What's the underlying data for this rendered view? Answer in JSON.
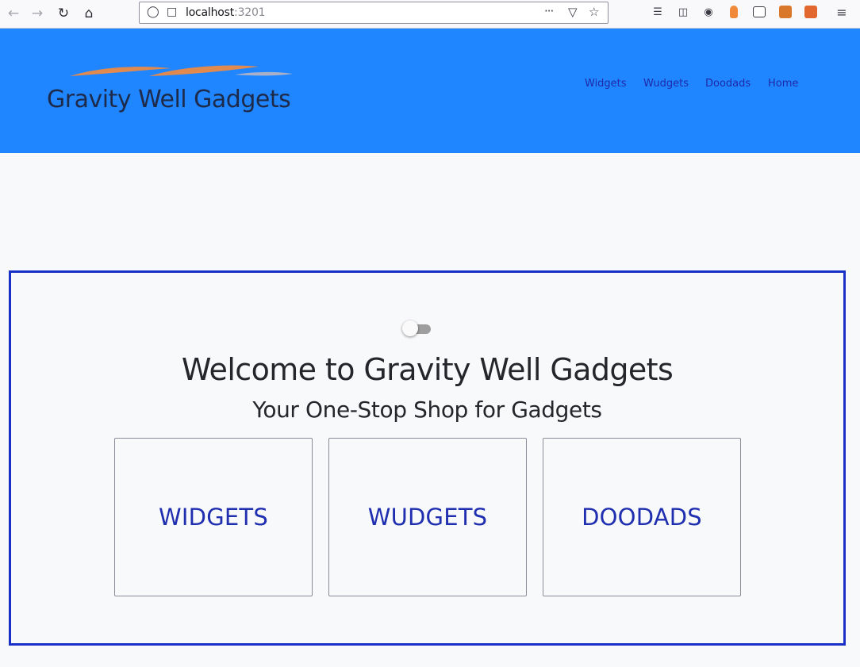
{
  "browser": {
    "url_host": "localhost",
    "url_port": ":3201",
    "more_actions": "···"
  },
  "header": {
    "brand": "Gravity Well Gadgets",
    "nav": [
      {
        "label": "Widgets"
      },
      {
        "label": "Wudgets"
      },
      {
        "label": "Doodads"
      },
      {
        "label": "Home"
      }
    ],
    "colors": {
      "background": "#1f86ff",
      "logo_swoosh": "#e08a50",
      "logo_swoosh_light": "#aab0c8"
    }
  },
  "main": {
    "title": "Welcome to Gravity Well Gadgets",
    "subtitle": "Your One-Stop Shop for Gadgets",
    "toggle_on": false,
    "cards": [
      {
        "label": "WIDGETS"
      },
      {
        "label": "WUDGETS"
      },
      {
        "label": "DOODADS"
      }
    ],
    "colors": {
      "panel_border": "#1a2fc6",
      "card_text": "#1f2fb0"
    }
  }
}
